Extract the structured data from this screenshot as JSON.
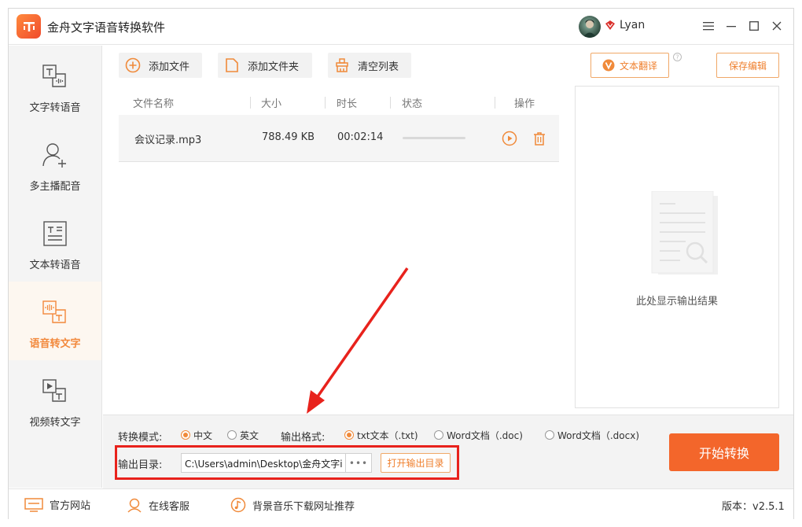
{
  "app": {
    "title": "金舟文字语音转换软件",
    "user_name": "Lyan"
  },
  "sidebar": {
    "items": [
      {
        "label": "文字转语音",
        "active": false
      },
      {
        "label": "多主播配音",
        "active": false
      },
      {
        "label": "文本转语音",
        "active": false
      },
      {
        "label": "语音转文字",
        "active": true
      },
      {
        "label": "视频转文字",
        "active": false
      }
    ]
  },
  "toolbar": {
    "add_file": "添加文件",
    "add_folder": "添加文件夹",
    "clear_list": "清空列表",
    "translate": "文本翻译",
    "save_edit": "保存编辑"
  },
  "table": {
    "columns": [
      "文件名称",
      "大小",
      "时长",
      "状态",
      "操作"
    ],
    "rows": [
      {
        "name": "会议记录.mp3",
        "size": "788.49 KB",
        "duration": "00:02:14",
        "progress": 0
      }
    ]
  },
  "preview": {
    "placeholder": "此处显示输出结果"
  },
  "settings": {
    "mode_label": "转换模式:",
    "mode_options": [
      "中文",
      "英文"
    ],
    "mode_selected": "中文",
    "format_label": "输出格式:",
    "format_options": [
      "txt文本（.txt)",
      "Word文档（.doc)",
      "Word文档（.docx)"
    ],
    "format_selected": "txt文本（.txt)",
    "dir_label": "输出目录:",
    "dir_value": "C:\\Users\\admin\\Desktop\\金舟文字i",
    "dots": "•••",
    "open_dir": "打开输出目录",
    "start": "开始转换"
  },
  "footer": {
    "website": "官方网站",
    "support": "在线客服",
    "music": "背景音乐下载网址推荐",
    "version": "版本：v2.5.1"
  },
  "colors": {
    "accent": "#f3662b",
    "accent_light": "#f2883b",
    "highlight": "#e8221c"
  }
}
